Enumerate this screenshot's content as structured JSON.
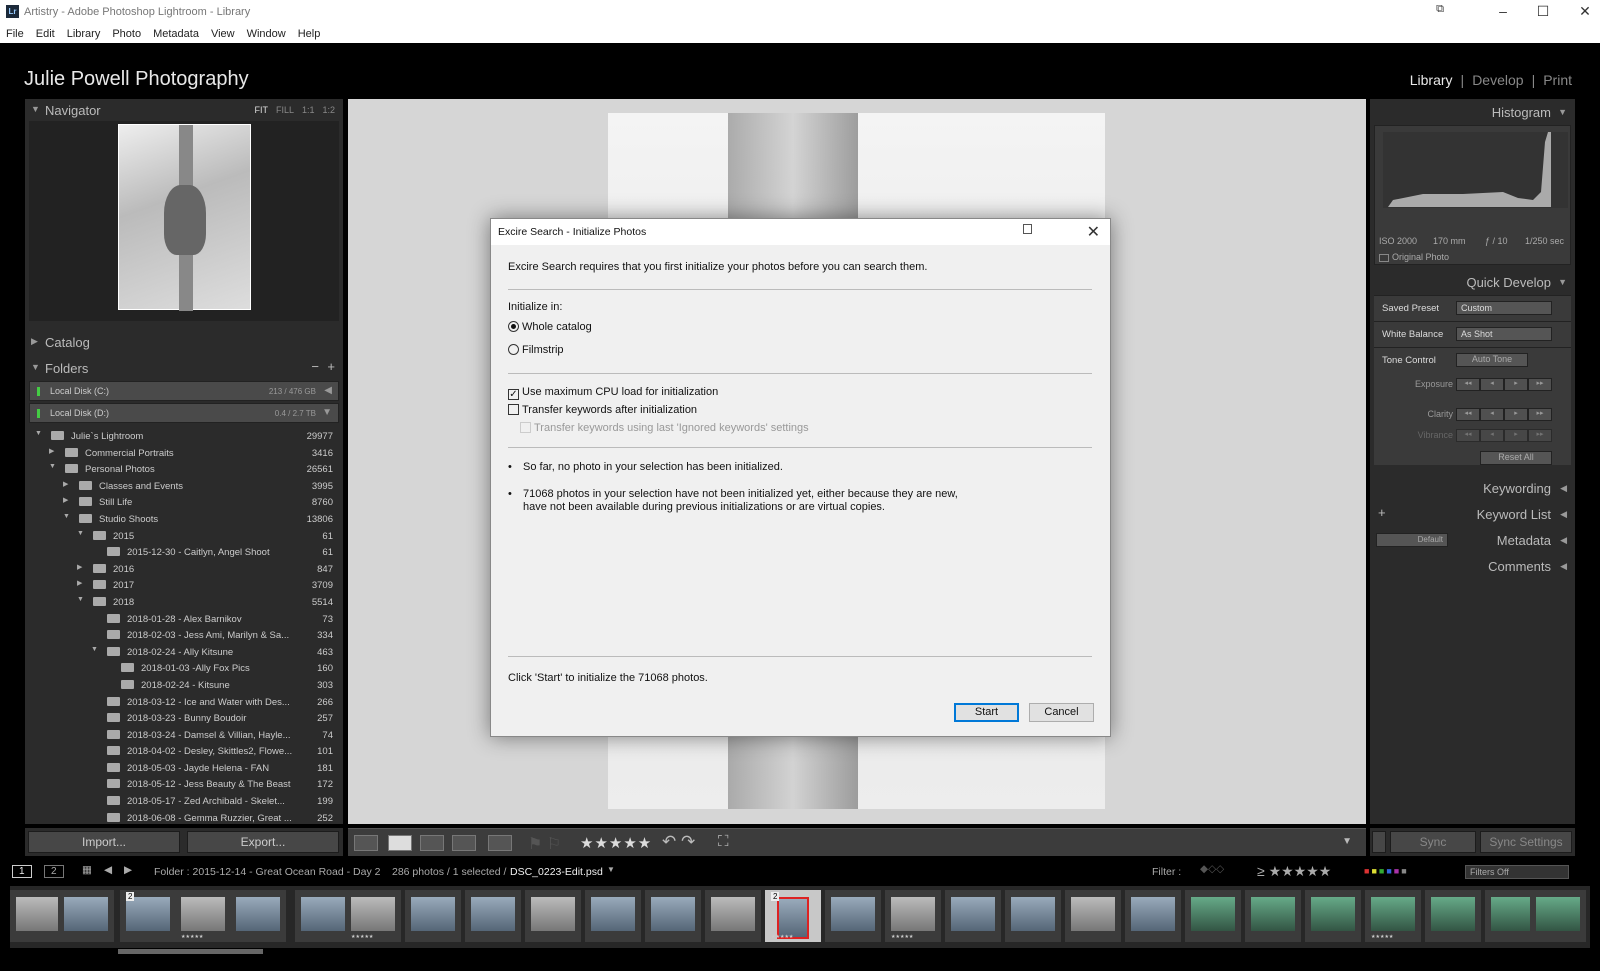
{
  "window": {
    "title": "Artistry - Adobe Photoshop Lightroom - Library",
    "logo": "Lr"
  },
  "menu": [
    "File",
    "Edit",
    "Library",
    "Photo",
    "Metadata",
    "View",
    "Window",
    "Help"
  ],
  "identity": "Julie Powell Photography",
  "modules": [
    "Library",
    "|",
    "Develop",
    "|",
    "Print"
  ],
  "navigator": {
    "title": "Navigator",
    "opts": [
      "FIT",
      "FILL",
      "1:1",
      "1:2"
    ]
  },
  "catalog": {
    "title": "Catalog"
  },
  "folders": {
    "title": "Folders",
    "disks": [
      {
        "name": "Local Disk (C:)",
        "size": "213 / 476 GB"
      },
      {
        "name": "Local Disk (D:)",
        "size": "0.4 / 2.7 TB"
      }
    ],
    "items": [
      {
        "d": 0,
        "t": "open",
        "n": "Julie`s Lightroom",
        "c": "29977"
      },
      {
        "d": 1,
        "t": "closed",
        "n": "Commercial Portraits",
        "c": "3416"
      },
      {
        "d": 1,
        "t": "open",
        "n": "Personal Photos",
        "c": "26561"
      },
      {
        "d": 2,
        "t": "closed",
        "n": "Classes and Events",
        "c": "3995"
      },
      {
        "d": 2,
        "t": "closed",
        "n": "Still Life",
        "c": "8760"
      },
      {
        "d": 2,
        "t": "open",
        "n": "Studio Shoots",
        "c": "13806"
      },
      {
        "d": 3,
        "t": "open",
        "n": "2015",
        "c": "61"
      },
      {
        "d": 4,
        "t": "",
        "n": "2015-12-30 - Caitlyn, Angel Shoot",
        "c": "61"
      },
      {
        "d": 3,
        "t": "closed",
        "n": "2016",
        "c": "847"
      },
      {
        "d": 3,
        "t": "closed",
        "n": "2017",
        "c": "3709"
      },
      {
        "d": 3,
        "t": "open",
        "n": "2018",
        "c": "5514"
      },
      {
        "d": 4,
        "t": "",
        "n": "2018-01-28 - Alex Barnikov",
        "c": "73"
      },
      {
        "d": 4,
        "t": "",
        "n": "2018-02-03 - Jess Ami, Marilyn & Sa...",
        "c": "334"
      },
      {
        "d": 4,
        "t": "open",
        "n": "2018-02-24 - Ally Kitsune",
        "c": "463"
      },
      {
        "d": 5,
        "t": "",
        "n": "2018-01-03 -Ally Fox Pics",
        "c": "160"
      },
      {
        "d": 5,
        "t": "",
        "n": "2018-02-24 - Kitsune",
        "c": "303"
      },
      {
        "d": 4,
        "t": "",
        "n": "2018-03-12 - Ice and Water with Des...",
        "c": "266"
      },
      {
        "d": 4,
        "t": "",
        "n": "2018-03-23 - Bunny Boudoir",
        "c": "257"
      },
      {
        "d": 4,
        "t": "",
        "n": "2018-03-24 - Damsel & Villian, Hayle...",
        "c": "74"
      },
      {
        "d": 4,
        "t": "",
        "n": "2018-04-02 - Desley, Skittles2, Flowe...",
        "c": "101"
      },
      {
        "d": 4,
        "t": "",
        "n": "2018-05-03 - Jayde Helena - FAN",
        "c": "181"
      },
      {
        "d": 4,
        "t": "",
        "n": "2018-05-12 - Jess Beauty & The Beast",
        "c": "172"
      },
      {
        "d": 4,
        "t": "",
        "n": "2018-05-17 - Zed Archibald - Skelet...",
        "c": "199"
      },
      {
        "d": 4,
        "t": "",
        "n": "2018-06-08 - Gemma Ruzzier, Great ...",
        "c": "252"
      }
    ]
  },
  "left_buttons": {
    "import": "Import...",
    "export": "Export..."
  },
  "histogram": {
    "title": "Histogram",
    "iso": "ISO 2000",
    "focal": "170 mm",
    "aperture": "ƒ / 10",
    "shutter": "1/250 sec",
    "original": "Original Photo"
  },
  "quick_develop": {
    "title": "Quick Develop",
    "saved_preset_label": "Saved Preset",
    "saved_preset": "Custom",
    "wb_label": "White Balance",
    "wb": "As Shot",
    "tone_label": "Tone Control",
    "auto_tone": "Auto Tone",
    "exposure": "Exposure",
    "clarity": "Clarity",
    "vibrance": "Vibrance",
    "reset": "Reset All",
    "arrows": [
      "◂◂",
      "◂",
      "▸",
      "▸▸"
    ]
  },
  "right_sections": {
    "keywording": "Keywording",
    "keyword_list": "Keyword List",
    "metadata": "Metadata",
    "metadata_preset": "Default",
    "comments": "Comments"
  },
  "right_buttons": {
    "sync": "Sync",
    "sync_settings": "Sync Settings"
  },
  "toolbar": {
    "stars": "★★★★★"
  },
  "filmstrip_bar": {
    "pages": [
      "1",
      "2"
    ],
    "source": "Folder : 2015-12-14 - Great Ocean Road - Day 2",
    "count": "286 photos / 1 selected /",
    "file": "DSC_0223-Edit.psd",
    "filter_label": "Filter :",
    "stars": "≥ ★★★★★",
    "filter_value": "Filters Off"
  },
  "filmstrip": {
    "badges": [
      "2",
      "2"
    ],
    "stars": "★★★★★"
  },
  "dialog": {
    "title": "Excire Search - Initialize Photos",
    "intro": "Excire Search requires that you first initialize your photos before you can search them.",
    "init_in": "Initialize in:",
    "opt_whole": "Whole catalog",
    "opt_filmstrip": "Filmstrip",
    "cb_cpu": "Use maximum CPU load for initialization",
    "cb_transfer": "Transfer keywords after initialization",
    "cb_ignored": "Transfer keywords using last 'Ignored keywords' settings",
    "bullet1": "So far, no photo in your selection has been initialized.",
    "bullet2": "71068 photos in your selection have not been initialized yet, either because they are new, have not been available during previous initializations or are virtual copies.",
    "footer": "Click 'Start' to initialize the 71068 photos.",
    "start": "Start",
    "cancel": "Cancel"
  }
}
